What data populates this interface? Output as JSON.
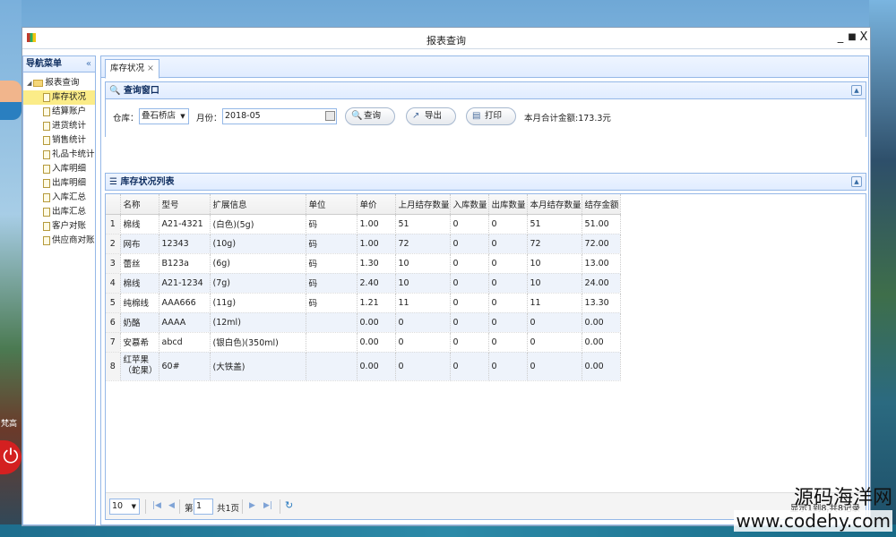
{
  "window": {
    "title": "报表查询",
    "minimize": "_",
    "maximize": "■",
    "close": "X"
  },
  "sidebar": {
    "title": "导航菜单",
    "collapse": "«",
    "root": "报表查询",
    "items": [
      {
        "label": "库存状况",
        "selected": true
      },
      {
        "label": "结算账户"
      },
      {
        "label": "进货统计"
      },
      {
        "label": "销售统计"
      },
      {
        "label": "礼品卡统计"
      },
      {
        "label": "入库明细"
      },
      {
        "label": "出库明细"
      },
      {
        "label": "入库汇总"
      },
      {
        "label": "出库汇总"
      },
      {
        "label": "客户对账"
      },
      {
        "label": "供应商对账"
      }
    ]
  },
  "tab": {
    "label": "库存状况",
    "close": "×"
  },
  "query": {
    "title": "查询窗口",
    "warehouse_label": "仓库：",
    "warehouse_value": "叠石桥店",
    "month_label": "月份：",
    "month_value": "2018-05",
    "search_label": "查询",
    "export_label": "导出",
    "print_label": "打印",
    "total_text": "本月合计金额:173.3元"
  },
  "grid": {
    "title": "库存状况列表",
    "columns": [
      "名称",
      "型号",
      "扩展信息",
      "单位",
      "单价",
      "上月结存数量",
      "入库数量",
      "出库数量",
      "本月结存数量",
      "结存金额"
    ],
    "rows": [
      {
        "n": "1",
        "cells": [
          "棉线",
          "A21-4321",
          "(白色)(5g)",
          "码",
          "1.00",
          "51",
          "0",
          "0",
          "51",
          "51.00"
        ]
      },
      {
        "n": "2",
        "cells": [
          "网布",
          "12343",
          "(10g)",
          "码",
          "1.00",
          "72",
          "0",
          "0",
          "72",
          "72.00"
        ]
      },
      {
        "n": "3",
        "cells": [
          "蕾丝",
          "B123a",
          "(6g)",
          "码",
          "1.30",
          "10",
          "0",
          "0",
          "10",
          "13.00"
        ]
      },
      {
        "n": "4",
        "cells": [
          "棉线",
          "A21-1234",
          "(7g)",
          "码",
          "2.40",
          "10",
          "0",
          "0",
          "10",
          "24.00"
        ]
      },
      {
        "n": "5",
        "cells": [
          "纯棉线",
          "AAA666",
          "(11g)",
          "码",
          "1.21",
          "11",
          "0",
          "0",
          "11",
          "13.30"
        ]
      },
      {
        "n": "6",
        "cells": [
          "奶酪",
          "AAAA",
          "(12ml)",
          "",
          "0.00",
          "0",
          "0",
          "0",
          "0",
          "0.00"
        ]
      },
      {
        "n": "7",
        "cells": [
          "安慕希",
          "abcd",
          "(银白色)(350ml)",
          "",
          "0.00",
          "0",
          "0",
          "0",
          "0",
          "0.00"
        ]
      },
      {
        "n": "8",
        "cells": [
          "红苹果（蛇果）",
          "60#",
          "(大铁盖)",
          "",
          "0.00",
          "0",
          "0",
          "0",
          "0",
          "0.00"
        ]
      }
    ]
  },
  "pager": {
    "page_size": "10",
    "page_prefix": "第",
    "page_value": "1",
    "page_suffix": "共1页",
    "record_text": "显示1到8,共8记录"
  },
  "desktop": {
    "side_text": "梵高",
    "watermark_cn": "源码海洋网",
    "watermark_url": "www.codehy.com"
  }
}
